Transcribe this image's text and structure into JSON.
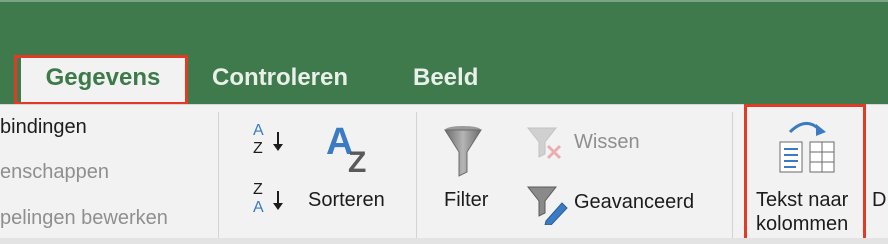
{
  "tabs": [
    {
      "label": "Gegevens",
      "active": true
    },
    {
      "label": "Controleren",
      "active": false
    },
    {
      "label": "Beeld",
      "active": false
    }
  ],
  "connections": {
    "items": [
      "bindingen",
      "enschappen",
      "pelingen bewerken"
    ]
  },
  "sort": {
    "az_top": "A",
    "az_bottom": "Z",
    "za_top": "Z",
    "za_bottom": "A",
    "label": "Sorteren"
  },
  "filter": {
    "filter_label": "Filter",
    "clear_label": "Wissen",
    "advanced_label": "Geavanceerd"
  },
  "text_to_columns": {
    "line1": "Tekst naar",
    "line2": "kolommen"
  },
  "next_group_partial": "D",
  "colors": {
    "ribbon_green": "#3e7a4c",
    "active_tab_text": "#3d7a4a",
    "highlight_red": "#e23b25",
    "icon_blue": "#3b7bc4"
  }
}
